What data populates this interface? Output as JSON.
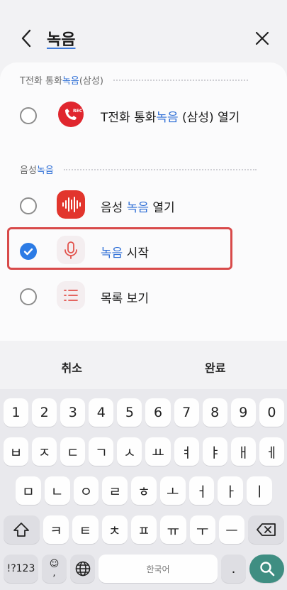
{
  "header": {
    "title": "녹음"
  },
  "sections": [
    {
      "prefix": "T전화 통화",
      "highlight": "녹음",
      "suffix": " (삼성)"
    },
    {
      "prefix": "음성 ",
      "highlight": "녹음",
      "suffix": ""
    }
  ],
  "rows": [
    {
      "prefix": "T전화 통화",
      "highlight": "녹음",
      "suffix": " (삼성) 열기",
      "icon": "call-recorder-icon",
      "checked": false
    },
    {
      "prefix": "음성 ",
      "highlight": "녹음",
      "suffix": " 열기",
      "icon": "voice-recorder-icon",
      "checked": false
    },
    {
      "prefix": "",
      "highlight": "녹음",
      "suffix": " 시작",
      "icon": "microphone-icon",
      "checked": true
    },
    {
      "prefix": "목록 보기",
      "highlight": "",
      "suffix": "",
      "icon": "list-icon",
      "checked": false
    }
  ],
  "rec_badge": "REC",
  "actions": {
    "cancel": "취소",
    "done": "완료"
  },
  "keyboard": {
    "numbers": [
      "1",
      "2",
      "3",
      "4",
      "5",
      "6",
      "7",
      "8",
      "9",
      "0"
    ],
    "row1": [
      "ㅂ",
      "ㅈ",
      "ㄷ",
      "ㄱ",
      "ㅅ",
      "ㅛ",
      "ㅕ",
      "ㅑ",
      "ㅐ",
      "ㅔ"
    ],
    "row2": [
      "ㅁ",
      "ㄴ",
      "ㅇ",
      "ㄹ",
      "ㅎ",
      "ㅗ",
      "ㅓ",
      "ㅏ",
      "ㅣ"
    ],
    "row3": [
      "ㅋ",
      "ㅌ",
      "ㅊ",
      "ㅍ",
      "ㅠ",
      "ㅜ",
      "ㅡ"
    ],
    "symbols": "!?123",
    "comma": ",",
    "space": "한국어",
    "period": "."
  },
  "colors": {
    "accent": "#2f6fd6",
    "check": "#2c7be5",
    "highlight_box": "#d84a4a",
    "search_key": "#3f8e82"
  }
}
